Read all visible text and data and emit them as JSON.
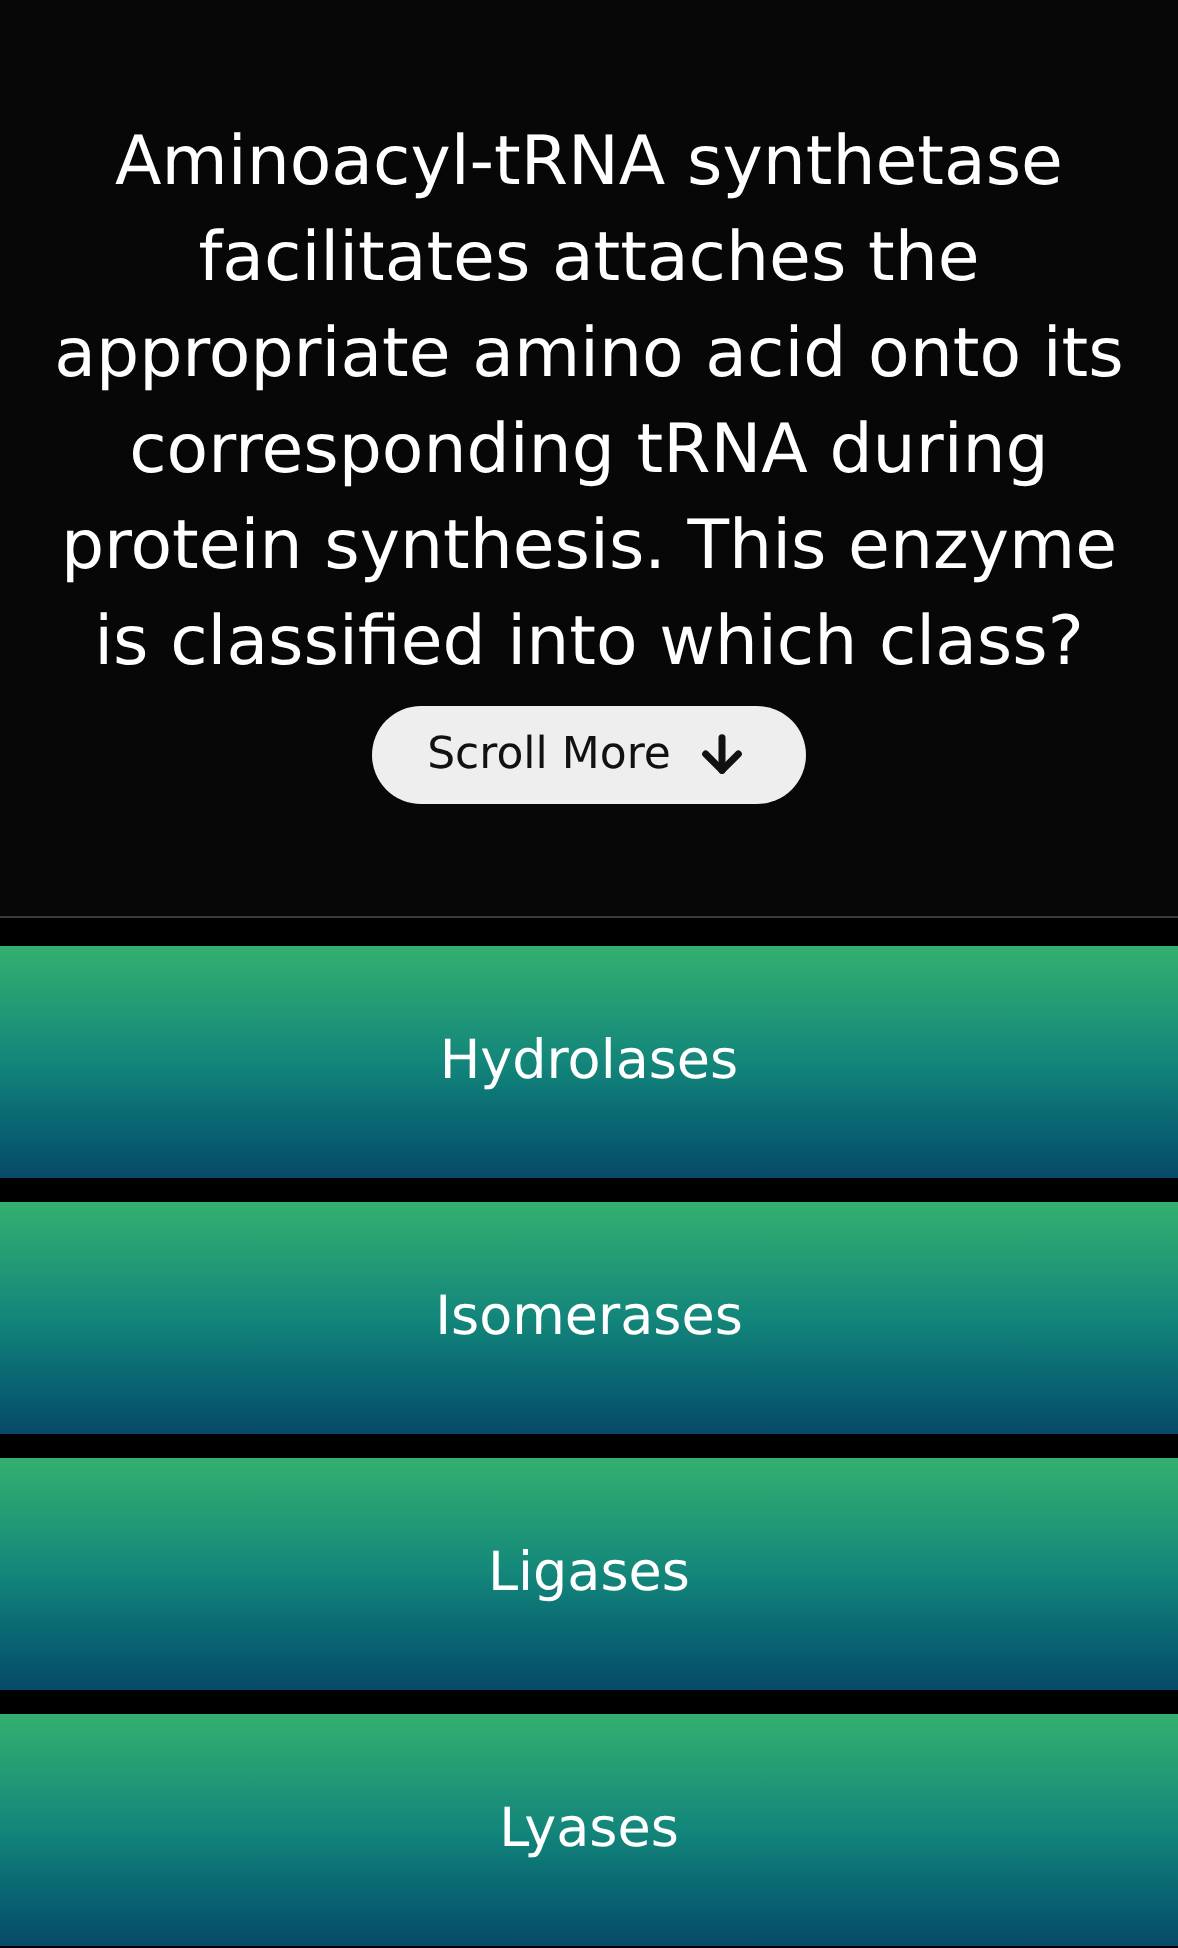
{
  "question": "Aminoacyl-tRNA synthetase facilitates attaches the appropriate amino acid onto its corresponding tRNA during protein synthesis. This enzyme is classified into which class?",
  "scroll_hint": {
    "label": "Scroll More"
  },
  "answers": [
    {
      "label": "Hydrolases"
    },
    {
      "label": "Isomerases"
    },
    {
      "label": "Ligases"
    },
    {
      "label": "Lyases"
    }
  ]
}
